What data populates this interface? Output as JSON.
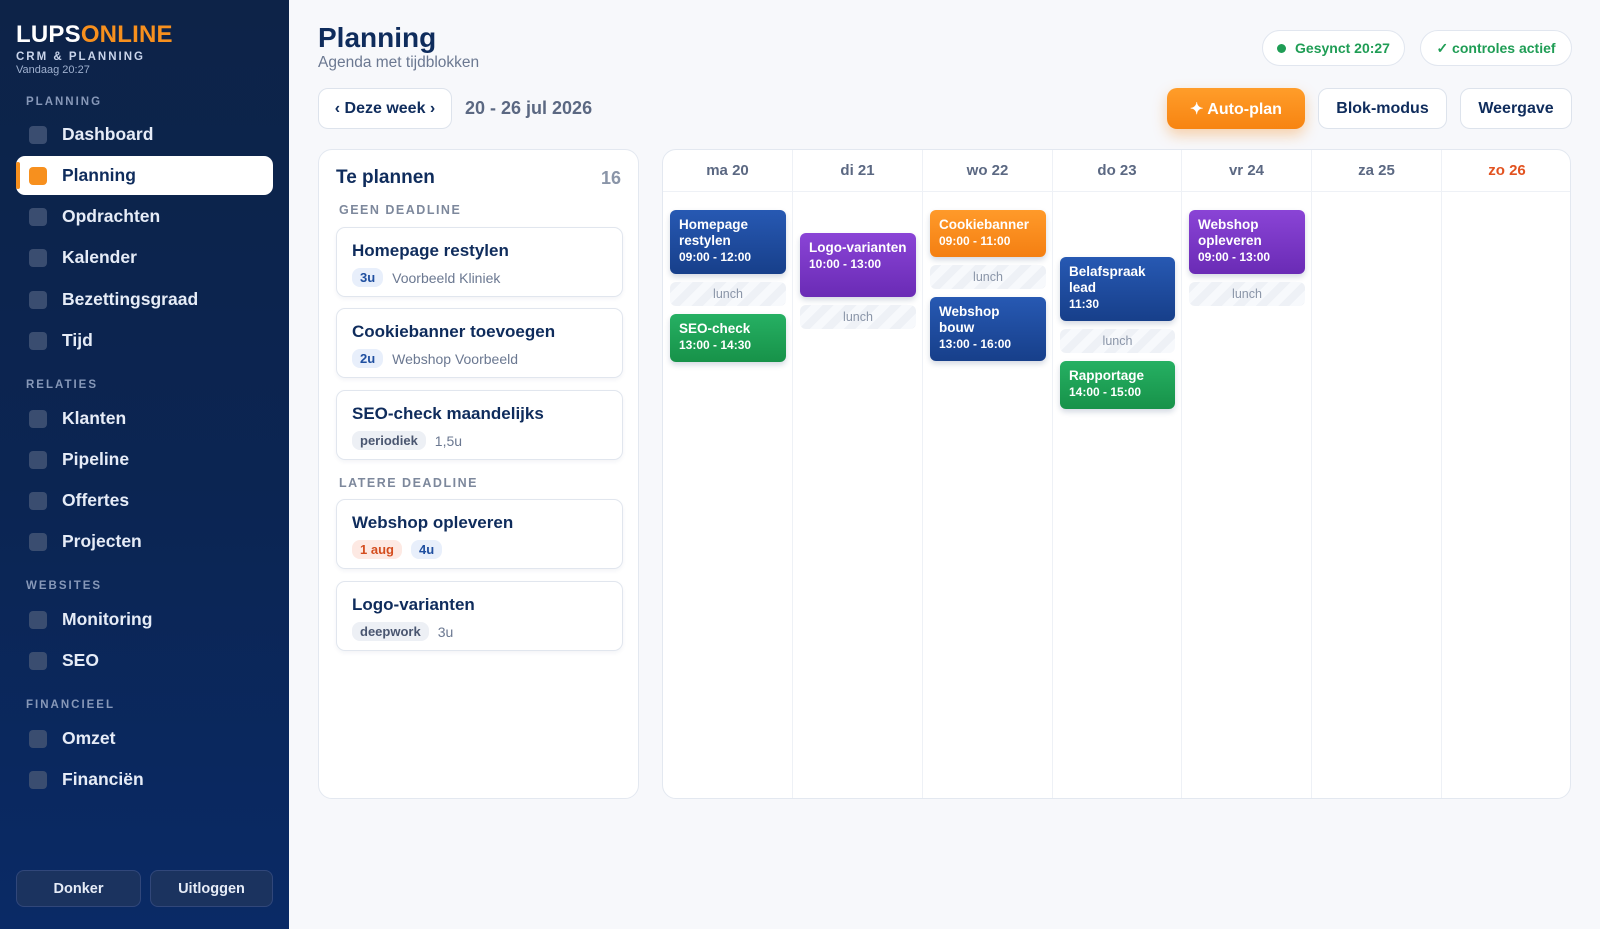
{
  "brand": {
    "name_a": "LUPS",
    "name_b": "ONLINE",
    "subtitle": "CRM & PLANNING",
    "time": "Vandaag 20:27"
  },
  "sidebar": {
    "sections": {
      "planning": "PLANNING",
      "relaties": "RELATIES",
      "websites": "WEBSITES",
      "financieel": "FINANCIEEL"
    },
    "items": {
      "dashboard": "Dashboard",
      "planning": "Planning",
      "opdrachten": "Opdrachten",
      "kalender": "Kalender",
      "bezettingsgraad": "Bezettingsgraad",
      "tijd": "Tijd",
      "klanten": "Klanten",
      "pipeline": "Pipeline",
      "offertes": "Offertes",
      "projecten": "Projecten",
      "monitoring": "Monitoring",
      "seo": "SEO",
      "omzet": "Omzet",
      "financien": "Financiën"
    },
    "active": "planning",
    "theme_button": "Donker",
    "logout_button": "Uitloggen"
  },
  "header": {
    "title": "Planning",
    "subtitle": "Agenda met tijdblokken",
    "sync_status": "Gesynct 20:27",
    "checks_status": "✓ controles actief",
    "week_button": "‹ Deze week ›",
    "date_range": "20 - 26 jul 2026",
    "autoplan_button": "✦ Auto-plan",
    "block_mode_button": "Blok-modus",
    "view_button": "Weergave"
  },
  "backlog": {
    "title": "Te plannen",
    "count": "16",
    "group_no_deadline": "GEEN DEADLINE",
    "group_later_deadline": "LATERE DEADLINE",
    "tasks": [
      {
        "title": "Homepage restylen",
        "tag": "3u",
        "meta": "Voorbeeld Kliniek"
      },
      {
        "title": "Cookiebanner toevoegen",
        "tag": "2u",
        "meta": "Webshop Voorbeeld"
      },
      {
        "title": "SEO-check maandelijks",
        "tag": "periodiek",
        "meta": "1,5u"
      },
      {
        "title": "Webshop opleveren",
        "tag": "1 aug",
        "tag2": "4u"
      },
      {
        "title": "Logo-varianten",
        "tag": "deepwork",
        "meta": "3u"
      }
    ]
  },
  "calendar": {
    "days": [
      "ma 20",
      "di 21",
      "wo 22",
      "do 23",
      "vr 24",
      "za 25",
      "zo 26"
    ],
    "lunch_label": "lunch",
    "events": [
      {
        "title": "Homepage restylen",
        "time": "09:00 - 12:00",
        "color": "#1f4fa0"
      },
      {
        "title": "SEO-check",
        "time": "13:00 - 14:30",
        "color": "#1f9d55"
      },
      {
        "title": "Logo-varianten",
        "time": "10:00 - 13:00",
        "color": "#7a36c6"
      },
      {
        "title": "Cookiebanner",
        "time": "09:00 - 11:00",
        "color": "#f7901e"
      },
      {
        "title": "Webshop bouw",
        "time": "13:00 - 16:00",
        "color": "#1f4fa0"
      },
      {
        "title": "Belafspraak lead",
        "time": "11:30",
        "color": "#1f4fa0"
      },
      {
        "title": "Rapportage",
        "time": "14:00 - 15:00",
        "color": "#1f9d55"
      },
      {
        "title": "Webshop opleveren",
        "time": "09:00 - 13:00",
        "color": "#7a36c6"
      }
    ]
  }
}
